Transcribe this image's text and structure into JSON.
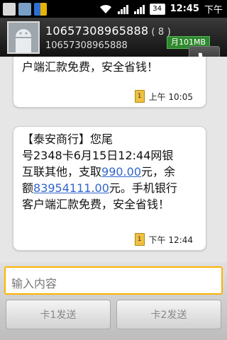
{
  "status": {
    "time": "12:45",
    "ampm": "下午",
    "battery": "34"
  },
  "header": {
    "title": "10657308965888",
    "count": "( 8 )",
    "number": "10657308965888",
    "data_usage": "月101MB"
  },
  "messages": [
    {
      "text_prefix": "户端汇款免费，安全省钱！",
      "time": "上午 10:05"
    },
    {
      "line1": "【泰安商行】您尾",
      "line2": "号2348卡6月15日12:44网银",
      "line3_pre": "互联其他，支取",
      "amount": "990.00",
      "line3_post": "元，余",
      "line4_pre": "额",
      "balance": "83954111.00",
      "line4_post": "元。手机银行",
      "line5": "客户端汇款免费，安全省钱！",
      "time": "下午 12:44"
    }
  ],
  "compose": {
    "placeholder": "输入内容",
    "send1": "卡1发送",
    "send2": "卡2发送"
  }
}
